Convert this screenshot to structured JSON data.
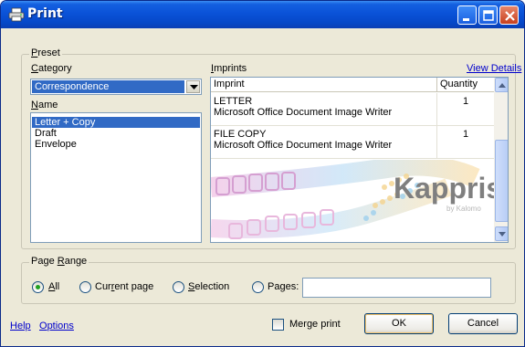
{
  "window": {
    "title": "Print"
  },
  "preset": {
    "group_label": "Preset",
    "category_label": "Category",
    "category_value": "Correspondence",
    "name_label": "Name",
    "names": [
      "Letter + Copy",
      "Draft",
      "Envelope"
    ],
    "selected_name_index": 0
  },
  "imprints": {
    "label": "Imprints",
    "view_details": "View Details",
    "columns": {
      "imprint": "Imprint",
      "quantity": "Quantity"
    },
    "rows": [
      {
        "name": "LETTER",
        "printer": "Microsoft Office Document Image Writer",
        "quantity": "1"
      },
      {
        "name": "FILE COPY",
        "printer": "Microsoft Office Document Image Writer",
        "quantity": "1"
      }
    ],
    "logo_text": "Kappris",
    "logo_subtext": "by Kalomo",
    "logo_color": "#808080"
  },
  "page_range": {
    "group_label": "Page Range",
    "options": [
      "All",
      "Current page",
      "Selection",
      "Pages:"
    ],
    "selected": "All",
    "pages_value": ""
  },
  "footer": {
    "help": "Help",
    "options": "Options",
    "merge_print": "Merge print",
    "merge_checked": false,
    "ok": "OK",
    "cancel": "Cancel"
  },
  "colors": {
    "titlebar": "#0a52d8",
    "selection": "#316ac5",
    "dialog_bg": "#ece9d8",
    "link": "#0000cc"
  }
}
